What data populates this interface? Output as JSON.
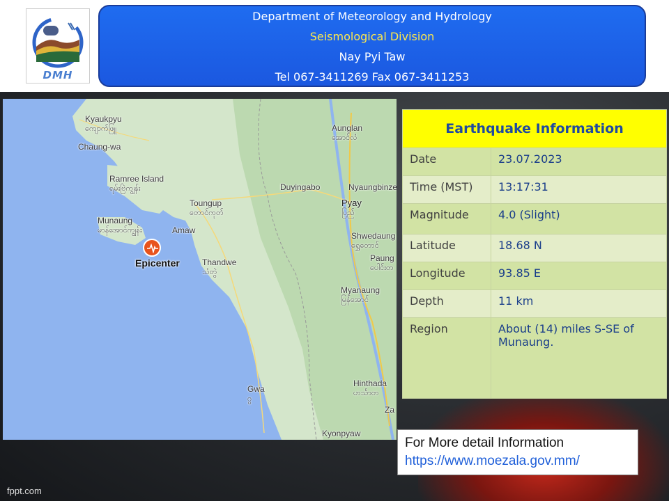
{
  "header": {
    "logo_text": "DMH",
    "line1": "Department of Meteorology and Hydrology",
    "line2": "Seismological Division",
    "line3": "Nay Pyi Taw",
    "line4": "Tel 067-3411269 Fax 067-3411253"
  },
  "map": {
    "epicenter_label": "Epicenter",
    "places": [
      {
        "name": "Kyaukpyu",
        "sub": "ကျောက်ဖြူ"
      },
      {
        "name": "Chaung-wa",
        "sub": ""
      },
      {
        "name": "Ramree Island",
        "sub": "ရမ်းဗြဲကျွန်း"
      },
      {
        "name": "Munaung",
        "sub": "မာန်အောင်ကျွန်း"
      },
      {
        "name": "Toungup",
        "sub": "တောင်ကုတ်"
      },
      {
        "name": "Amaw",
        "sub": ""
      },
      {
        "name": "Thandwe",
        "sub": "သံတွဲ"
      },
      {
        "name": "Aunglan",
        "sub": "အောင်လံ"
      },
      {
        "name": "Duyingabo",
        "sub": ""
      },
      {
        "name": "Nyaungbinze",
        "sub": ""
      },
      {
        "name": "Pyay",
        "sub": "ပြည်"
      },
      {
        "name": "Shwedaung",
        "sub": "ရွှေတောင်"
      },
      {
        "name": "Paung",
        "sub": "ပေါင်းတ"
      },
      {
        "name": "Myanaung",
        "sub": "မြန်အောင်"
      },
      {
        "name": "Gwa",
        "sub": "ဂွ"
      },
      {
        "name": "Hinthada",
        "sub": "ဟင်္သာတ"
      },
      {
        "name": "Za",
        "sub": ""
      },
      {
        "name": "Kyonpyaw",
        "sub": ""
      }
    ]
  },
  "info": {
    "title": "Earthquake Information",
    "rows": [
      {
        "label": "Date",
        "value": "23.07.2023"
      },
      {
        "label": "Time (MST)",
        "value": "13:17:31"
      },
      {
        "label": "Magnitude",
        "value": "4.0 (Slight)"
      },
      {
        "label": "Latitude",
        "value": "18.68 N"
      },
      {
        "label": "Longitude",
        "value": "93.85 E"
      },
      {
        "label": "Depth",
        "value": "11 km"
      },
      {
        "label": "Region",
        "value": "About (14) miles S-SE of Munaung."
      }
    ]
  },
  "more": {
    "line1": "For More detail Information",
    "link": "https://www.moezala.gov.mm/"
  },
  "footer": "fppt.com"
}
